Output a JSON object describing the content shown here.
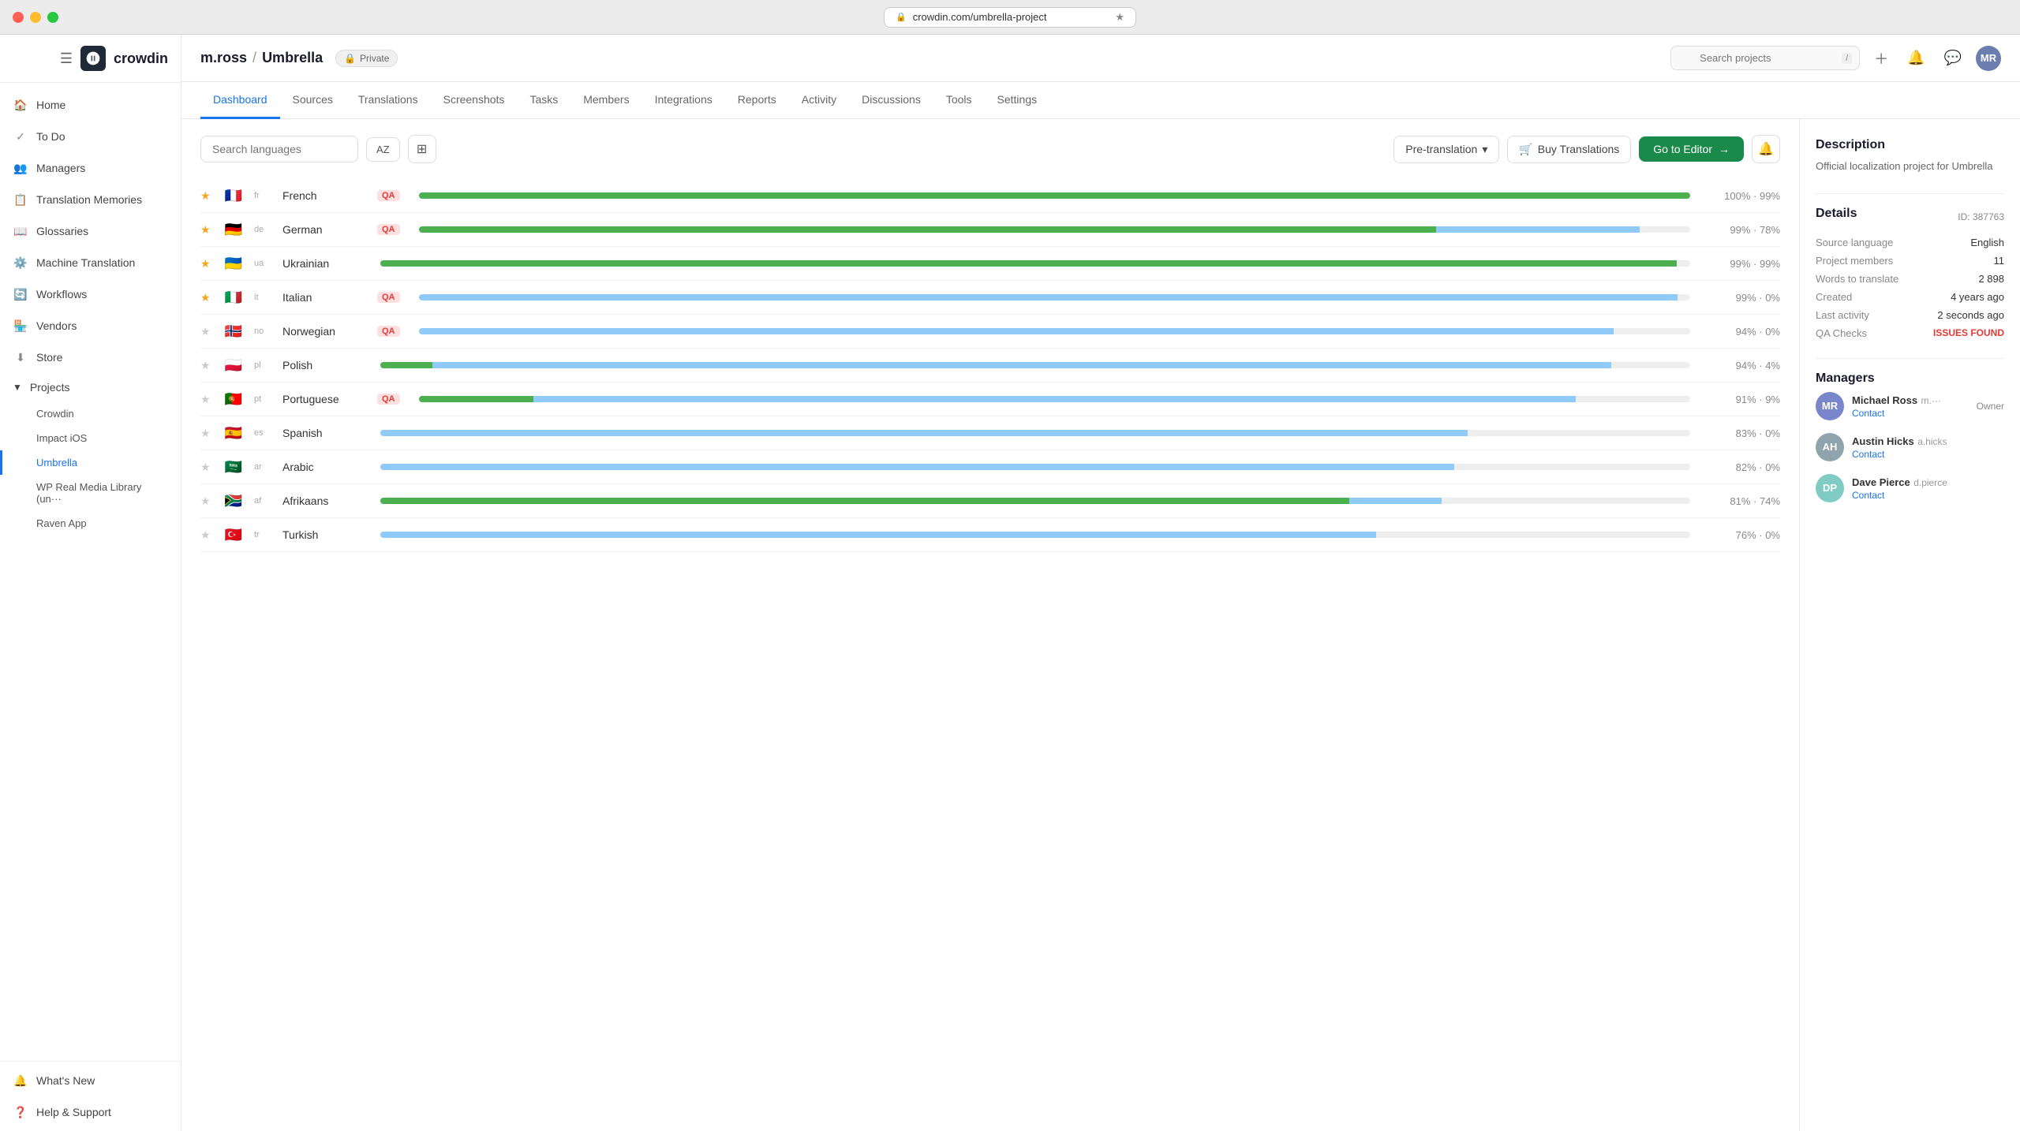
{
  "titleBar": {
    "url": "crowdin.com/umbrella-project"
  },
  "sidebar": {
    "brand": "crowdin",
    "nav": [
      {
        "id": "home",
        "label": "Home",
        "icon": "home"
      },
      {
        "id": "todo",
        "label": "To Do",
        "icon": "todo"
      },
      {
        "id": "managers",
        "label": "Managers",
        "icon": "managers"
      },
      {
        "id": "translation-memories",
        "label": "Translation Memories",
        "icon": "tm"
      },
      {
        "id": "glossaries",
        "label": "Glossaries",
        "icon": "glossaries"
      },
      {
        "id": "machine-translation",
        "label": "Machine Translation",
        "icon": "mt"
      },
      {
        "id": "workflows",
        "label": "Workflows",
        "icon": "workflows"
      },
      {
        "id": "vendors",
        "label": "Vendors",
        "icon": "vendors"
      },
      {
        "id": "store",
        "label": "Store",
        "icon": "store"
      }
    ],
    "projects": {
      "label": "Projects",
      "items": [
        {
          "id": "crowdin",
          "label": "Crowdin"
        },
        {
          "id": "impact-ios",
          "label": "Impact iOS"
        },
        {
          "id": "umbrella",
          "label": "Umbrella",
          "active": true
        },
        {
          "id": "wp-real-media",
          "label": "WP Real Media Library (un···"
        },
        {
          "id": "raven-app",
          "label": "Raven App"
        }
      ]
    },
    "bottom": [
      {
        "id": "whats-new",
        "label": "What's New",
        "icon": "whats-new"
      },
      {
        "id": "help",
        "label": "Help & Support",
        "icon": "help"
      }
    ]
  },
  "header": {
    "breadcrumb_user": "m.ross",
    "breadcrumb_sep": "/",
    "breadcrumb_project": "Umbrella",
    "private_label": "Private",
    "search_placeholder": "Search projects",
    "search_shortcut": "/"
  },
  "tabs": [
    {
      "id": "dashboard",
      "label": "Dashboard",
      "active": true
    },
    {
      "id": "sources",
      "label": "Sources"
    },
    {
      "id": "translations",
      "label": "Translations"
    },
    {
      "id": "screenshots",
      "label": "Screenshots"
    },
    {
      "id": "tasks",
      "label": "Tasks"
    },
    {
      "id": "members",
      "label": "Members"
    },
    {
      "id": "integrations",
      "label": "Integrations"
    },
    {
      "id": "reports",
      "label": "Reports"
    },
    {
      "id": "activity",
      "label": "Activity"
    },
    {
      "id": "discussions",
      "label": "Discussions"
    },
    {
      "id": "tools",
      "label": "Tools"
    },
    {
      "id": "settings",
      "label": "Settings"
    }
  ],
  "toolbar": {
    "search_placeholder": "Search languages",
    "sort_label": "AZ",
    "grid_label": "⊞",
    "pre_translation_label": "Pre-translation",
    "buy_translations_label": "Buy Translations",
    "go_editor_label": "Go to Editor"
  },
  "languages": [
    {
      "code": "FR",
      "flag": "🇫🇷",
      "name": "French",
      "qa": true,
      "starred": true,
      "green": 100,
      "blue": 0,
      "pct": "100% · 99%"
    },
    {
      "code": "DE",
      "flag": "🇩🇪",
      "name": "German",
      "qa": true,
      "starred": true,
      "green": 80,
      "blue": 16,
      "pct": "99% · 78%"
    },
    {
      "code": "UA",
      "flag": "🇺🇦",
      "name": "Ukrainian",
      "qa": false,
      "starred": true,
      "green": 99,
      "blue": 0,
      "pct": "99% · 99%"
    },
    {
      "code": "IT",
      "flag": "🇮🇹",
      "name": "Italian",
      "qa": true,
      "starred": true,
      "green": 0,
      "blue": 99,
      "pct": "99% · 0%"
    },
    {
      "code": "NO",
      "flag": "🇳🇴",
      "name": "Norwegian",
      "qa": true,
      "starred": false,
      "green": 0,
      "blue": 94,
      "pct": "94% · 0%"
    },
    {
      "code": "PL",
      "flag": "🇵🇱",
      "name": "Polish",
      "qa": false,
      "starred": false,
      "green": 4,
      "blue": 90,
      "pct": "94% · 4%"
    },
    {
      "code": "PT",
      "flag": "🇵🇹",
      "name": "Portuguese",
      "qa": true,
      "starred": false,
      "green": 9,
      "blue": 82,
      "pct": "91% · 9%"
    },
    {
      "code": "ES",
      "flag": "🇪🇸",
      "name": "Spanish",
      "qa": false,
      "starred": false,
      "green": 0,
      "blue": 83,
      "pct": "83% · 0%"
    },
    {
      "code": "AR",
      "flag": "🇸🇦",
      "name": "Arabic",
      "qa": false,
      "starred": false,
      "green": 0,
      "blue": 82,
      "pct": "82% · 0%"
    },
    {
      "code": "AF",
      "flag": "🇿🇦",
      "name": "Afrikaans",
      "qa": false,
      "starred": false,
      "green": 74,
      "blue": 7,
      "pct": "81% · 74%"
    },
    {
      "code": "TR",
      "flag": "🇹🇷",
      "name": "Turkish",
      "qa": false,
      "starred": false,
      "green": 0,
      "blue": 76,
      "pct": "76% · 0%"
    }
  ],
  "rightPanel": {
    "description_title": "Description",
    "description_text": "Official localization project for Umbrella",
    "details_title": "Details",
    "project_id": "ID: 387763",
    "source_language_label": "Source language",
    "source_language_value": "English",
    "project_members_label": "Project members",
    "project_members_value": "11",
    "words_to_translate_label": "Words to translate",
    "words_to_translate_value": "2 898",
    "created_label": "Created",
    "created_value": "4 years ago",
    "last_activity_label": "Last activity",
    "last_activity_value": "2 seconds ago",
    "qa_checks_label": "QA Checks",
    "qa_checks_value": "ISSUES FOUND",
    "managers_title": "Managers",
    "managers": [
      {
        "name": "Michael Ross",
        "handle": "m.···",
        "initials": "MR",
        "role": "Owner",
        "contact": "Contact",
        "bg": "#7986cb"
      },
      {
        "name": "Austin Hicks",
        "handle": "a.hicks",
        "initials": "AH",
        "role": "",
        "contact": "Contact",
        "bg": "#90a4ae"
      },
      {
        "name": "Dave Pierce",
        "handle": "d.pierce",
        "initials": "DP",
        "role": "",
        "contact": "Contact",
        "bg": "#80cbc4"
      }
    ]
  }
}
